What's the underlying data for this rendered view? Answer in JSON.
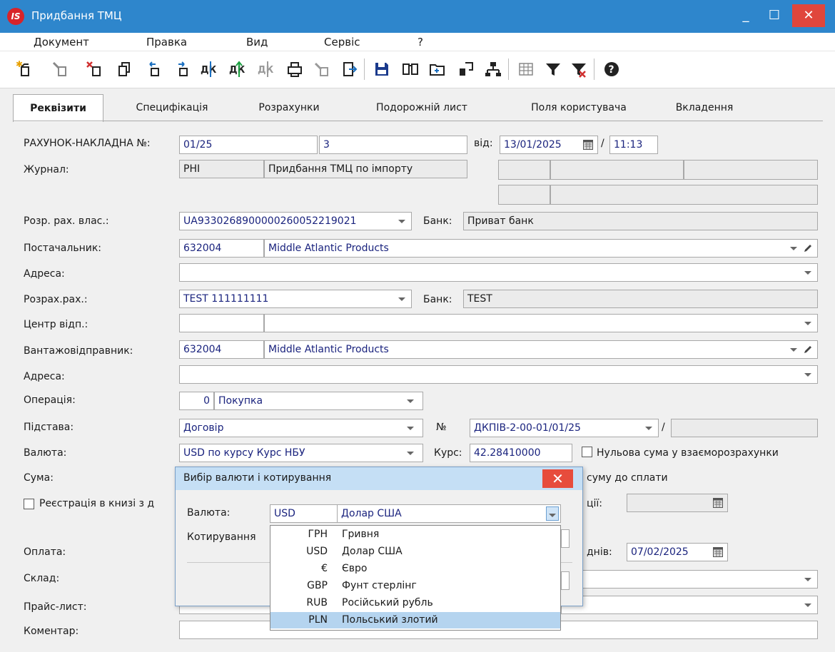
{
  "window": {
    "title": "Придбання ТМЦ",
    "logo": "IS",
    "minimize": "_",
    "maximize": "☐",
    "close": "✕"
  },
  "menu": [
    "Документ",
    "Правка",
    "Вид",
    "Сервіс",
    "?"
  ],
  "toolbar": [
    "new-icon",
    "edit-icon",
    "delete-icon",
    "copy-icon",
    "undo-icon",
    "redo-icon",
    "debit-credit-icon",
    "debit-credit-green-icon",
    "debit-credit-gray-icon",
    "print-icon",
    "disabled-icon",
    "export-icon",
    "save-icon",
    "book-icon",
    "open-folder-icon",
    "link-icon",
    "tree-icon",
    "grid-icon",
    "filter-icon",
    "clear-filter-icon",
    "help-icon"
  ],
  "tabs": [
    "Реквізити",
    "Специфікація",
    "Розрахунки",
    "Подорожній лист",
    "Поля користувача",
    "Вкладення"
  ],
  "form": {
    "invoice_label": "РАХУНОК-НАКЛАДНА №:",
    "invoice_no": "01/25",
    "invoice_suffix": "3",
    "date_label": "від:",
    "date": "13/01/2025",
    "slash": "/",
    "time": "11:13",
    "journal_label": "Журнал:",
    "journal_code": "PHI",
    "journal_name": "Придбання ТМЦ по імпорту",
    "own_account_label": "Розр. рах. влас.:",
    "own_account": "UA933026890000026005221​9021",
    "bank_label": "Банк:",
    "own_bank": "Приват банк",
    "supplier_label": "Постачальник:",
    "supplier_code": "632004",
    "supplier_name": "Middle Atlantic Products",
    "address_label": "Адреса:",
    "settle_account_label": "Розрах.рах.:",
    "settle_account": "TEST 111111111",
    "settle_bank": "TEST",
    "center_label": "Центр відп.:",
    "shipper_label": "Вантажовідправник:",
    "shipper_code": "632004",
    "shipper_name": "Middle Atlantic Products",
    "address2_label": "Адреса:",
    "operation_label": "Операція:",
    "operation_code": "0",
    "operation_name": "Покупка",
    "basis_label": "Підстава:",
    "basis": "Договір",
    "no_label": "№",
    "basis_no": "ДКПІВ-2-00-01/01/25",
    "currency_label": "Валюта:",
    "currency": "USD по курсу Курс НБУ",
    "rate_label": "Курс:",
    "rate": "42.28410000",
    "zero_sum_label": "Нульова сума у взаєморозрахунки",
    "sum_label": "Сума:",
    "sum_to_pay_label": "суму до сплати",
    "registration_label": "Реєстрація в книзі з д",
    "tion_label": "ції:",
    "payment_label": "Оплата:",
    "days_label": "днів:",
    "pay_date": "07/02/2025",
    "warehouse_label": "Склад:",
    "pricelist_label": "Прайс-лист:",
    "comment_label": "Коментар:"
  },
  "dialog": {
    "title": "Вибір валюти і котирування",
    "close": "✕",
    "currency_label": "Валюта:",
    "currency_code": "USD",
    "currency_name": "Долар США",
    "quote_label": "Котирування"
  },
  "currency_list": [
    {
      "code": "ГРН",
      "name": "Гривня"
    },
    {
      "code": "USD",
      "name": "Долар США"
    },
    {
      "code": "€",
      "name": "Євро"
    },
    {
      "code": "GBP",
      "name": "Фунт стерлінг"
    },
    {
      "code": "RUB",
      "name": "Російський рубль"
    },
    {
      "code": "PLN",
      "name": "Польський злотий"
    }
  ],
  "colors": {
    "titlebar": "#2e86cc",
    "accent_text": "#1a237e",
    "selection": "#b5d4ef",
    "close": "#e0463c"
  }
}
